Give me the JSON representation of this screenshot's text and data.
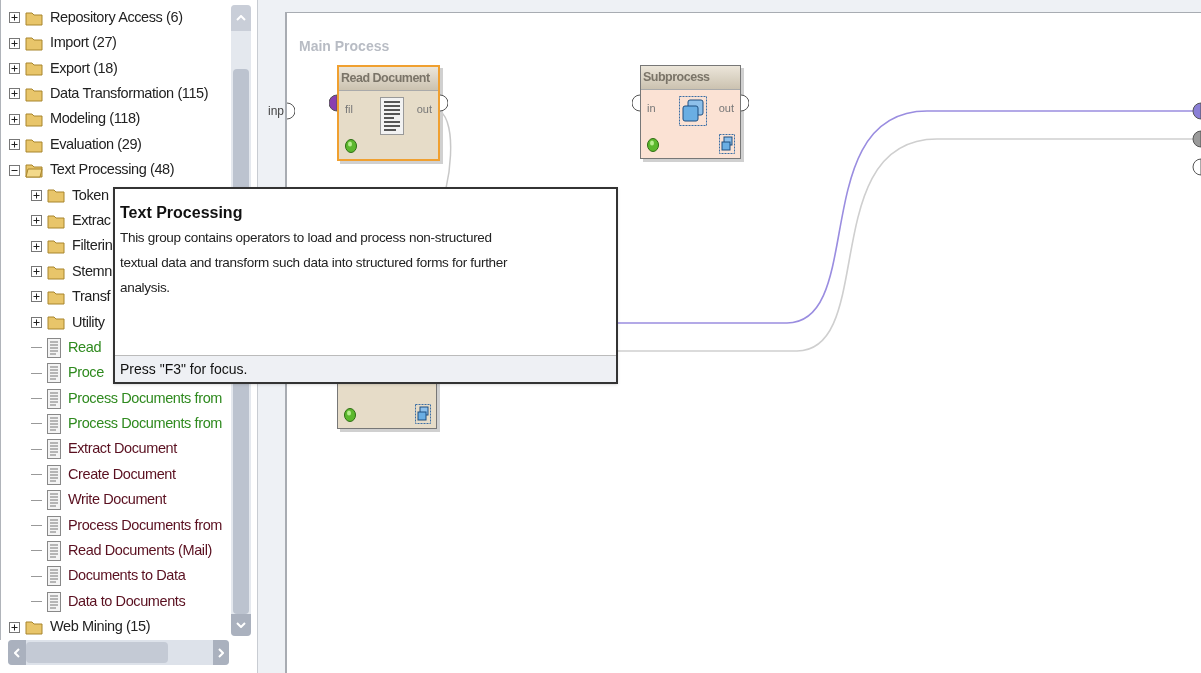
{
  "tree": [
    {
      "label": "Repository Access (6)",
      "kind": "folder",
      "expanded": false
    },
    {
      "label": "Import (27)",
      "kind": "folder",
      "expanded": false
    },
    {
      "label": "Export (18)",
      "kind": "folder",
      "expanded": false
    },
    {
      "label": "Data Transformation (115)",
      "kind": "folder",
      "expanded": false
    },
    {
      "label": "Modeling (118)",
      "kind": "folder",
      "expanded": false
    },
    {
      "label": "Evaluation (29)",
      "kind": "folder",
      "expanded": false
    },
    {
      "label": "Text Processing (48)",
      "kind": "folder",
      "expanded": true,
      "children": [
        {
          "label": "Token",
          "kind": "folder",
          "expanded": false
        },
        {
          "label": "Extrac",
          "kind": "folder",
          "expanded": false
        },
        {
          "label": "Filterin",
          "kind": "folder",
          "expanded": false
        },
        {
          "label": "Stemn",
          "kind": "folder",
          "expanded": false
        },
        {
          "label": "Transf",
          "kind": "folder",
          "expanded": false
        },
        {
          "label": "Utility",
          "kind": "folder",
          "expanded": false
        },
        {
          "label": "Read",
          "kind": "operator",
          "color": "#2f8a1f"
        },
        {
          "label": "Proce",
          "kind": "operator",
          "color": "#2f8a1f"
        },
        {
          "label": "Process Documents from",
          "kind": "operator",
          "color": "#2f8a1f"
        },
        {
          "label": "Process Documents from",
          "kind": "operator",
          "color": "#2f8a1f"
        },
        {
          "label": "Extract Document",
          "kind": "operator",
          "color": "#5a1020"
        },
        {
          "label": "Create Document",
          "kind": "operator",
          "color": "#5a1020"
        },
        {
          "label": "Write Document",
          "kind": "operator",
          "color": "#5a1020"
        },
        {
          "label": "Process Documents from",
          "kind": "operator",
          "color": "#5a1020"
        },
        {
          "label": "Read Documents (Mail)",
          "kind": "operator",
          "color": "#5a1020"
        },
        {
          "label": "Documents to Data",
          "kind": "operator",
          "color": "#5a1020"
        },
        {
          "label": "Data to Documents",
          "kind": "operator",
          "color": "#5a1020"
        }
      ]
    },
    {
      "label": "Web Mining (15)",
      "kind": "folder",
      "expanded": false
    }
  ],
  "canvas": {
    "title": "Main Process",
    "input_port": "inp",
    "operators": [
      {
        "name": "Read Document",
        "kind": "document",
        "color": "#e6dcc8",
        "selected": true,
        "port_in": "fil",
        "port_out": "out"
      },
      {
        "name": "Subprocess",
        "kind": "subprocess",
        "color": "#fbe2d4",
        "selected": false,
        "port_in": "in",
        "port_out": "out"
      },
      {
        "kind": "subprocess",
        "color": "#e6dcc8",
        "selected": false
      }
    ]
  },
  "tooltip": {
    "title": "Text Processing",
    "text": "This group contains operators to load and process non-structured textual data and transform such data into structured forms for further analysis.",
    "footer": "Press \"F3\" for focus."
  }
}
